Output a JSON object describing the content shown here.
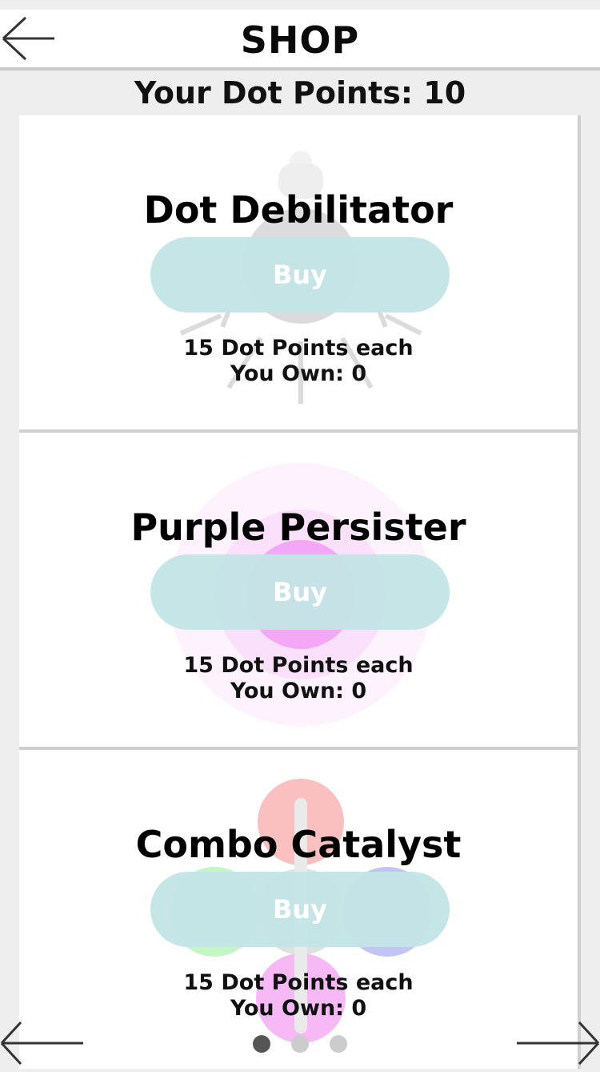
{
  "header": {
    "title": "SHOP",
    "back_icon": "arrow-left-icon"
  },
  "points_label": "Your Dot Points: 10",
  "items": [
    {
      "name": "Dot Debilitator",
      "buy_label": "Buy",
      "price_label": "15 Dot Points each",
      "owned_label": "You Own: 0",
      "icon": "lightbulb-icon"
    },
    {
      "name": "Purple Persister",
      "buy_label": "Buy",
      "price_label": "15 Dot Points each",
      "owned_label": "You Own: 0",
      "icon": "purple-dot-icon"
    },
    {
      "name": "Combo Catalyst",
      "buy_label": "Buy",
      "price_label": "15 Dot Points each",
      "owned_label": "You Own: 0",
      "icon": "combo-dots-icon"
    }
  ],
  "pagination": {
    "total": 3,
    "active": 1,
    "prev_icon": "arrow-left-icon",
    "next_icon": "arrow-right-icon"
  },
  "colors": {
    "buy_button": "#c4e4e6",
    "dot_active": "#555555",
    "dot_inactive": "#cccccc",
    "purple": "#f4a7f4",
    "red": "#f9b4b4",
    "green": "#b4f4b4",
    "blue": "#b4b4f4"
  }
}
